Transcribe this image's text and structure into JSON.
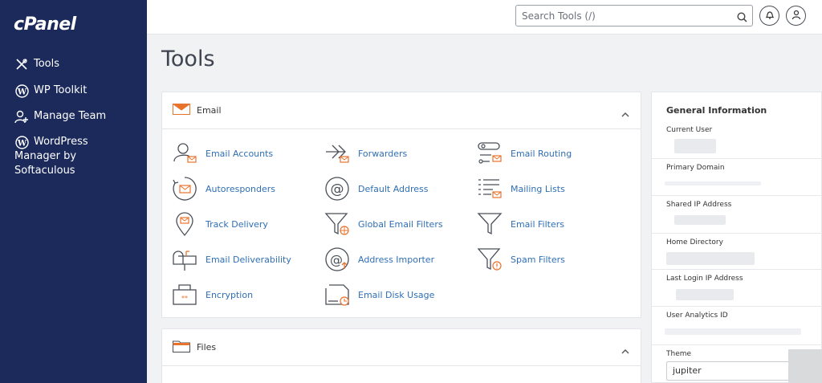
{
  "brand": {
    "logo": "cPanel"
  },
  "sidebar": {
    "items": [
      {
        "label": "Tools",
        "icon": "tools-icon"
      },
      {
        "label": "WP Toolkit",
        "icon": "wordpress-icon"
      },
      {
        "label": "Manage Team",
        "icon": "team-icon"
      },
      {
        "label": "WordPress\nManager by\nSoftaculous",
        "icon": "wordpress-icon"
      }
    ]
  },
  "header": {
    "search_placeholder": "Search Tools (/)",
    "icons": [
      "search-icon",
      "bell-icon",
      "user-icon"
    ]
  },
  "page": {
    "title": "Tools"
  },
  "email_panel": {
    "title": "Email",
    "accent": "#e8732c",
    "tools": [
      {
        "label": "Email Accounts",
        "icon": "email-accounts-icon"
      },
      {
        "label": "Forwarders",
        "icon": "forwarders-icon"
      },
      {
        "label": "Email Routing",
        "icon": "email-routing-icon"
      },
      {
        "label": "Autoresponders",
        "icon": "autoresponders-icon"
      },
      {
        "label": "Default Address",
        "icon": "default-address-icon"
      },
      {
        "label": "Mailing Lists",
        "icon": "mailing-lists-icon"
      },
      {
        "label": "Track Delivery",
        "icon": "track-delivery-icon"
      },
      {
        "label": "Global Email Filters",
        "icon": "global-email-filters-icon"
      },
      {
        "label": "Email Filters",
        "icon": "email-filters-icon"
      },
      {
        "label": "Email Deliverability",
        "icon": "email-deliverability-icon"
      },
      {
        "label": "Address Importer",
        "icon": "address-importer-icon"
      },
      {
        "label": "Spam Filters",
        "icon": "spam-filters-icon"
      },
      {
        "label": "Encryption",
        "icon": "encryption-icon"
      },
      {
        "label": "Email Disk Usage",
        "icon": "email-disk-usage-icon"
      }
    ]
  },
  "files_panel": {
    "title": "Files"
  },
  "general_info": {
    "title": "General Information",
    "rows": [
      {
        "label": "Current User"
      },
      {
        "label": "Primary Domain"
      },
      {
        "label": "Shared IP Address"
      },
      {
        "label": "Home Directory"
      },
      {
        "label": "Last Login IP Address"
      },
      {
        "label": "User Analytics ID"
      },
      {
        "label": "Theme"
      }
    ],
    "theme_value": "jupiter"
  },
  "colors": {
    "sidebar": "#1b2a5a",
    "link": "#2f6fb5",
    "accent": "#e8732c"
  }
}
